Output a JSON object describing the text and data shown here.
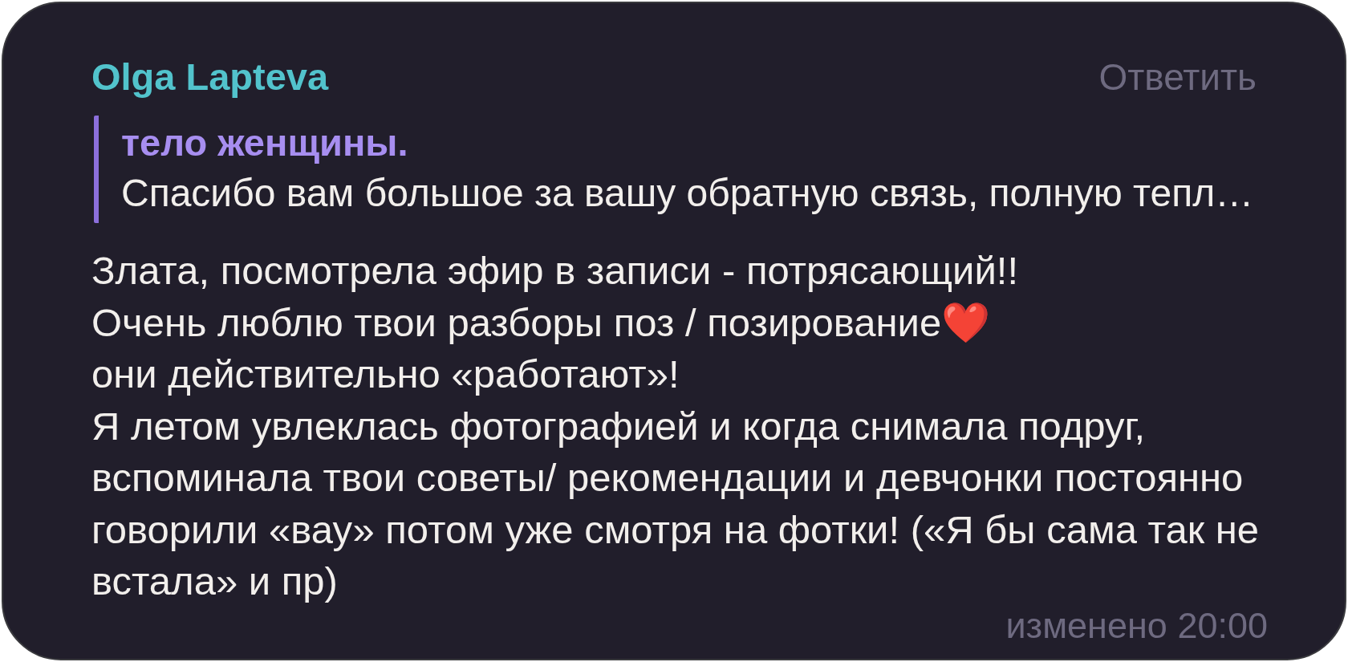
{
  "message": {
    "author": "Olga Lapteva",
    "reply_action": "Ответить",
    "quote": {
      "title": "тело женщины.",
      "text": "Спасибо вам большое за вашу обратную связь, полную тепл…"
    },
    "text": "Злата, посмотрела эфир в записи - потрясающий!!\nОчень люблю твои разборы поз / позирование❤️\nони действительно «работают»!\nЯ летом увлеклась фотографией и когда снимала подруг, вспоминала твои советы/ рекомендации и девчонки постоянно говорили «вау» потом уже смотря на фотки! («Я бы сама так не встала» и пр)",
    "status": "изменено 20:00"
  }
}
